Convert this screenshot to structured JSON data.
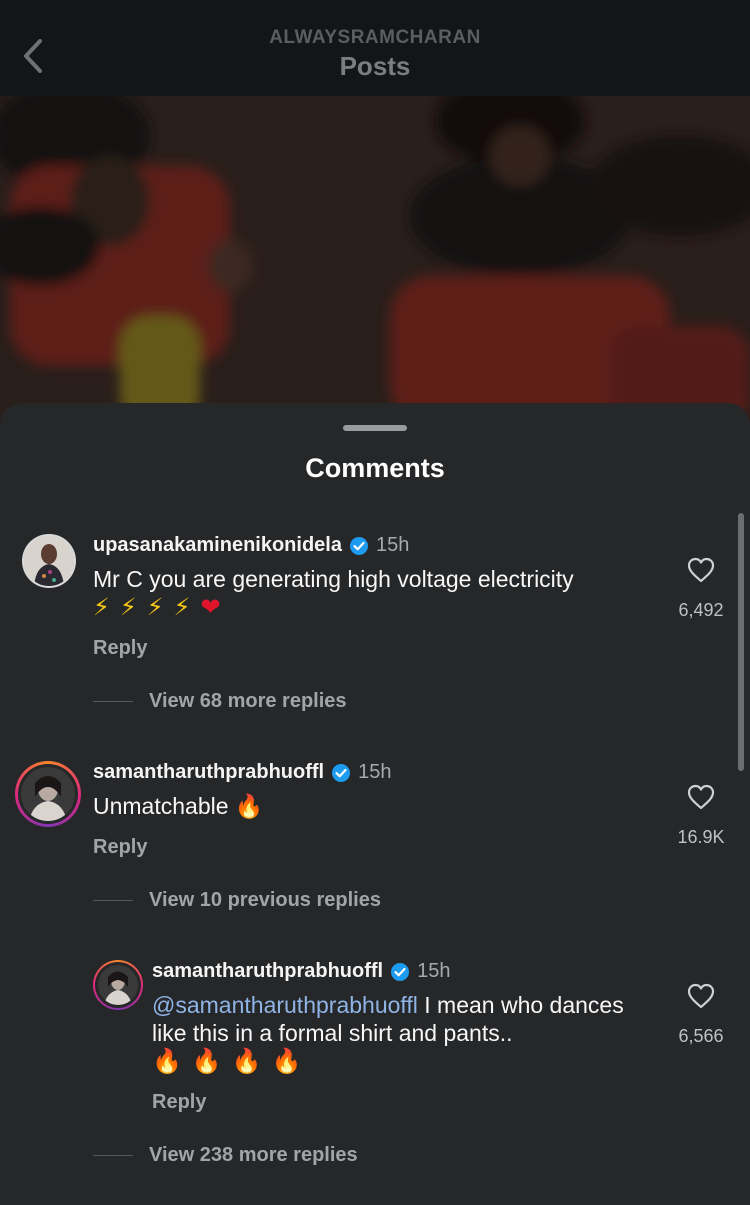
{
  "header": {
    "subtitle": "ALWAYSRAMCHARAN",
    "title": "Posts"
  },
  "sheet": {
    "title": "Comments"
  },
  "comments": [
    {
      "username": "upasanakaminenikonidela",
      "verified": true,
      "time": "15h",
      "text": "Mr C you are generating high voltage electricity",
      "emojis": [
        "⚡",
        "⚡",
        "⚡",
        "⚡",
        "❤"
      ],
      "reply_label": "Reply",
      "likes": "6,492",
      "view_replies": "View 68 more replies"
    },
    {
      "username": "samantharuthprabhuoffl",
      "verified": true,
      "time": "15h",
      "text": "Unmatchable 🔥",
      "reply_label": "Reply",
      "likes": "16.9K",
      "view_replies": "View 10 previous replies",
      "reply": {
        "username": "samantharuthprabhuoffl",
        "verified": true,
        "time": "15h",
        "mention": "@samantharuthprabhuoffl",
        "text": "I mean who dances like this in a formal shirt and pants..",
        "emojis": [
          "🔥",
          "🔥",
          "🔥",
          "🔥"
        ],
        "reply_label": "Reply",
        "likes": "6,566"
      },
      "more_replies": "View 238 more replies"
    }
  ],
  "colors": {
    "sheet_bg": "#262729",
    "verified": "#1d9bf0",
    "story_ring": "#dd2a7b"
  },
  "icons": {
    "back": "chevron-left-icon",
    "like": "heart-outline-icon",
    "verified": "verified-badge-icon"
  }
}
